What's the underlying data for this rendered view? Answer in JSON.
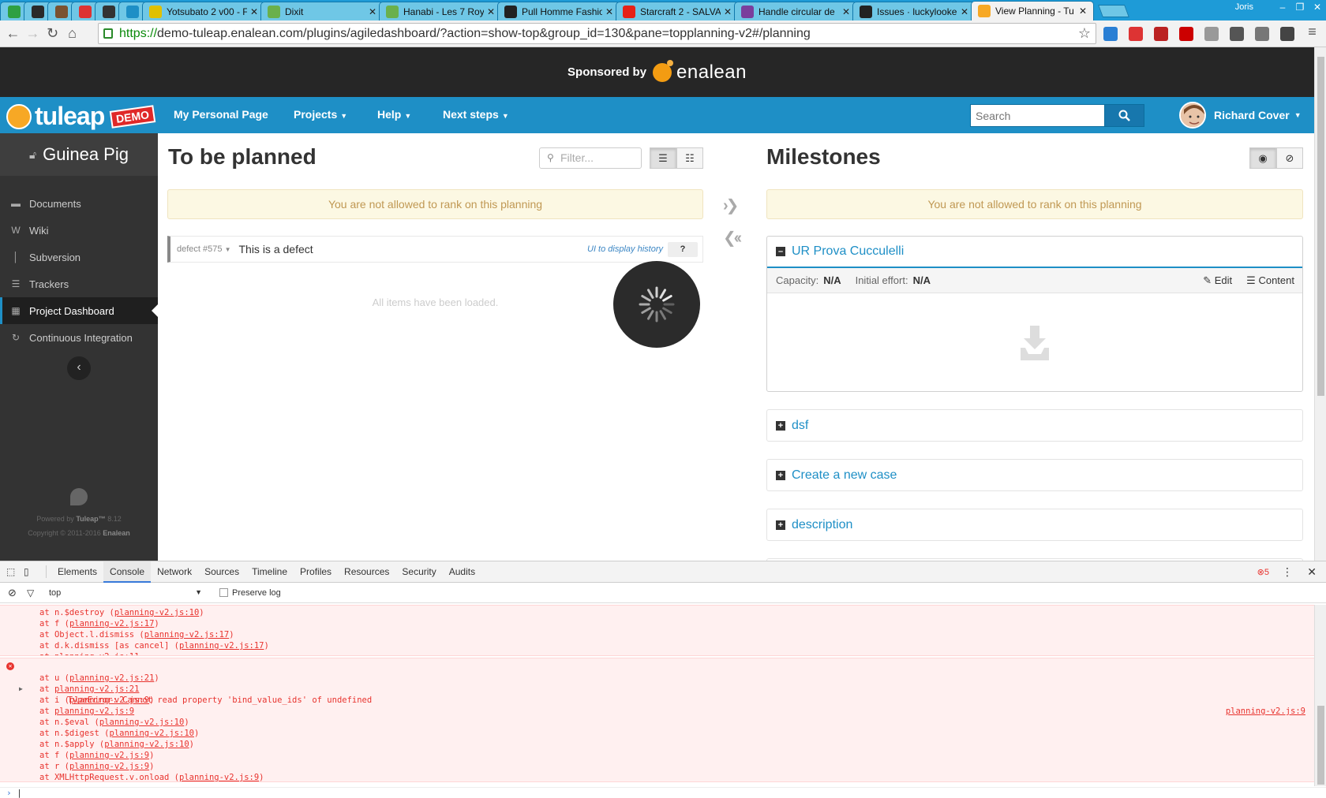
{
  "browser": {
    "tabs": [
      {
        "title": "",
        "fav": "#2ea043",
        "kind": "small"
      },
      {
        "title": "",
        "fav": "#2a2a2a",
        "kind": "small"
      },
      {
        "title": "",
        "fav": "#7a5230",
        "kind": "small"
      },
      {
        "title": "",
        "fav": "#d33",
        "kind": "small"
      },
      {
        "title": "",
        "fav": "#333",
        "kind": "small"
      },
      {
        "title": "",
        "fav": "#1e8fc6",
        "kind": "small"
      },
      {
        "title": "Yotsubato 2 v00 - F",
        "fav": "#e0c000",
        "kind": "normal"
      },
      {
        "title": "Dixit",
        "fav": "#6ab04c",
        "kind": "normal"
      },
      {
        "title": "Hanabi - Les 7 Roy",
        "fav": "#6ab04c",
        "kind": "normal"
      },
      {
        "title": "Pull Homme Fashio",
        "fav": "#222",
        "kind": "normal"
      },
      {
        "title": "Starcraft 2 - SALVA",
        "fav": "#e62117",
        "kind": "normal"
      },
      {
        "title": "Handle circular de",
        "fav": "#7a3e9d",
        "kind": "normal"
      },
      {
        "title": "Issues · luckylooke",
        "fav": "#222",
        "kind": "normal"
      },
      {
        "title": "View Planning - Tu",
        "fav": "#f7a825",
        "kind": "normal",
        "active": true
      }
    ],
    "window_user": "Joris",
    "url_scheme": "https://",
    "url_rest": "demo-tuleap.enalean.com/plugins/agiledashboard/?action=show-top&group_id=130&pane=topplanning-v2#/planning"
  },
  "sponsor": {
    "label": "Sponsored by",
    "brand": "enalean"
  },
  "header": {
    "logo_text": "tuleap",
    "demo_badge": "DEMO",
    "menu": [
      {
        "label": "My Personal Page",
        "caret": false
      },
      {
        "label": "Projects",
        "caret": true
      },
      {
        "label": "Help",
        "caret": true
      },
      {
        "label": "Next steps",
        "caret": true
      }
    ],
    "search_placeholder": "Search",
    "user_name": "Richard Cover"
  },
  "sidebar": {
    "project": "Guinea Pig",
    "items": [
      {
        "label": "Documents",
        "icon": "folder-icon",
        "glyph": "▬"
      },
      {
        "label": "Wiki",
        "icon": "wiki-icon",
        "glyph": "W"
      },
      {
        "label": "Subversion",
        "icon": "subversion-icon",
        "glyph": "│"
      },
      {
        "label": "Trackers",
        "icon": "list-icon",
        "glyph": "☰"
      },
      {
        "label": "Project Dashboard",
        "icon": "table-icon",
        "glyph": "▦",
        "active": true
      },
      {
        "label": "Continuous Integration",
        "icon": "refresh-icon",
        "glyph": "↻"
      }
    ],
    "powered_by": "Powered by",
    "powered_brand": "Tuleap™",
    "version": "8.12",
    "copyright": "Copyright © 2011-2016",
    "copyright_brand": "Enalean"
  },
  "backlog": {
    "title": "To be planned",
    "filter_placeholder": "Filter...",
    "warning": "You are not allowed to rank on this planning",
    "item": {
      "ref": "defect #575",
      "title": "This is a defect",
      "history_link": "UI to display history",
      "points": "?"
    },
    "loaded_message": "All items have been loaded."
  },
  "milestones": {
    "title": "Milestones",
    "warning": "You are not allowed to rank on this planning",
    "open": {
      "title": "UR Prova Cucculelli",
      "capacity_label": "Capacity:",
      "capacity_value": "N/A",
      "effort_label": "Initial effort:",
      "effort_value": "N/A",
      "edit_label": "Edit",
      "content_label": "Content"
    },
    "closed": [
      "dsf",
      "Create a new case",
      "description"
    ]
  },
  "devtools": {
    "tabs": [
      "Elements",
      "Console",
      "Network",
      "Sources",
      "Timeline",
      "Profiles",
      "Resources",
      "Security",
      "Audits"
    ],
    "active_tab": "Console",
    "error_count": "5",
    "context": "top",
    "preserve_log": "Preserve log",
    "prev_stack": [
      {
        "fn": "at n.$destroy (",
        "file": "planning-v2.js:10",
        "end": ")"
      },
      {
        "fn": "at f (",
        "file": "planning-v2.js:17",
        "end": ")"
      },
      {
        "fn": "at Object.l.dismiss (",
        "file": "planning-v2.js:17",
        "end": ")"
      },
      {
        "fn": "at d.k.dismiss [as cancel] (",
        "file": "planning-v2.js:17",
        "end": ")"
      },
      {
        "fn": "at ",
        "file": "planning-v2.js:11",
        "end": ""
      }
    ],
    "error_message": "TypeError: Cannot read property 'bind_value_ids' of undefined",
    "error_source": "planning-v2.js:9",
    "stack": [
      {
        "fn": "at u (",
        "file": "planning-v2.js:21",
        "end": ")"
      },
      {
        "fn": "at ",
        "file": "planning-v2.js:21",
        "end": ""
      },
      {
        "fn": "at i (",
        "file": "planning-v2.js:9",
        "end": ")"
      },
      {
        "fn": "at ",
        "file": "planning-v2.js:9",
        "end": ""
      },
      {
        "fn": "at n.$eval (",
        "file": "planning-v2.js:10",
        "end": ")"
      },
      {
        "fn": "at n.$digest (",
        "file": "planning-v2.js:10",
        "end": ")"
      },
      {
        "fn": "at n.$apply (",
        "file": "planning-v2.js:10",
        "end": ")"
      },
      {
        "fn": "at f (",
        "file": "planning-v2.js:9",
        "end": ")"
      },
      {
        "fn": "at r (",
        "file": "planning-v2.js:9",
        "end": ")"
      },
      {
        "fn": "at XMLHttpRequest.v.onload (",
        "file": "planning-v2.js:9",
        "end": ")"
      }
    ]
  }
}
